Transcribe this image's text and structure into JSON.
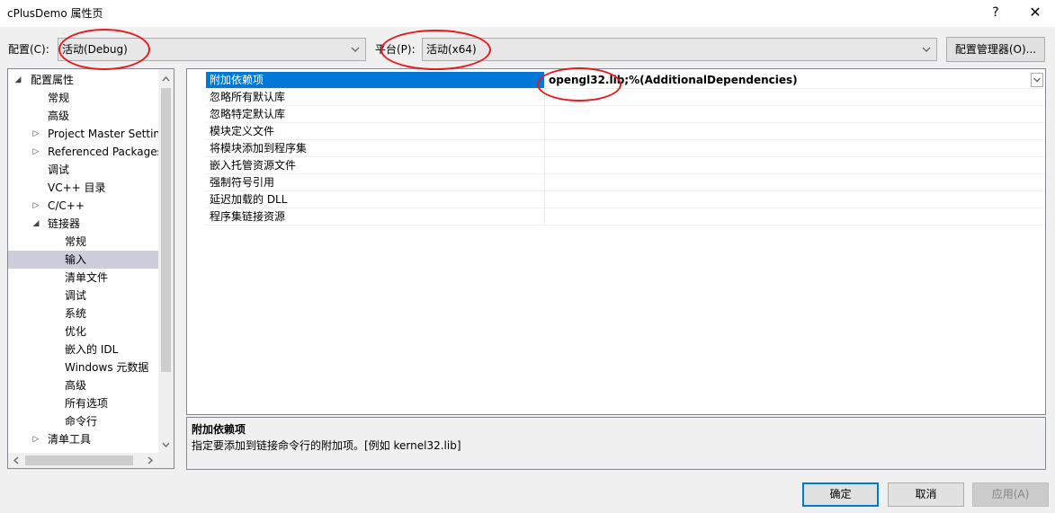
{
  "window": {
    "title": "cPlusDemo 属性页",
    "help_glyph": "?",
    "close_glyph": "✕"
  },
  "config_bar": {
    "config_label": "配置(C):",
    "config_value": "活动(Debug)",
    "platform_label": "平台(P):",
    "platform_value": "活动(x64)",
    "config_manager_button": "配置管理器(O)..."
  },
  "tree": {
    "items": [
      {
        "label": "配置属性",
        "expander": "◢"
      },
      {
        "label": "常规",
        "expander": ""
      },
      {
        "label": "高级",
        "expander": ""
      },
      {
        "label": "Project Master Settings",
        "expander": "▷"
      },
      {
        "label": "Referenced Packages",
        "expander": "▷"
      },
      {
        "label": "调试",
        "expander": ""
      },
      {
        "label": "VC++ 目录",
        "expander": ""
      },
      {
        "label": "C/C++",
        "expander": "▷"
      },
      {
        "label": "链接器",
        "expander": "◢"
      },
      {
        "label": "常规",
        "expander": ""
      },
      {
        "label": "输入",
        "expander": ""
      },
      {
        "label": "清单文件",
        "expander": ""
      },
      {
        "label": "调试",
        "expander": ""
      },
      {
        "label": "系统",
        "expander": ""
      },
      {
        "label": "优化",
        "expander": ""
      },
      {
        "label": "嵌入的 IDL",
        "expander": ""
      },
      {
        "label": "Windows 元数据",
        "expander": ""
      },
      {
        "label": "高级",
        "expander": ""
      },
      {
        "label": "所有选项",
        "expander": ""
      },
      {
        "label": "命令行",
        "expander": ""
      },
      {
        "label": "清单工具",
        "expander": "▷"
      }
    ],
    "selected": "输入"
  },
  "properties": {
    "rows": [
      {
        "name": "附加依赖项",
        "value": "opengl32.lib;%(AdditionalDependencies)"
      },
      {
        "name": "忽略所有默认库",
        "value": ""
      },
      {
        "name": "忽略特定默认库",
        "value": ""
      },
      {
        "name": "模块定义文件",
        "value": ""
      },
      {
        "name": "将模块添加到程序集",
        "value": ""
      },
      {
        "name": "嵌入托管资源文件",
        "value": ""
      },
      {
        "name": "强制符号引用",
        "value": ""
      },
      {
        "name": "延迟加载的 DLL",
        "value": ""
      },
      {
        "name": "程序集链接资源",
        "value": ""
      }
    ],
    "selected": "附加依赖项"
  },
  "description": {
    "title": "附加依赖项",
    "text": "指定要添加到链接命令行的附加项。[例如 kernel32.lib]"
  },
  "buttons": {
    "ok": "确定",
    "cancel": "取消",
    "apply": "应用(A)"
  },
  "colors": {
    "selection_blue": "#0078d7",
    "tree_selection": "#cccedb",
    "annotation_red": "#e8191f"
  }
}
